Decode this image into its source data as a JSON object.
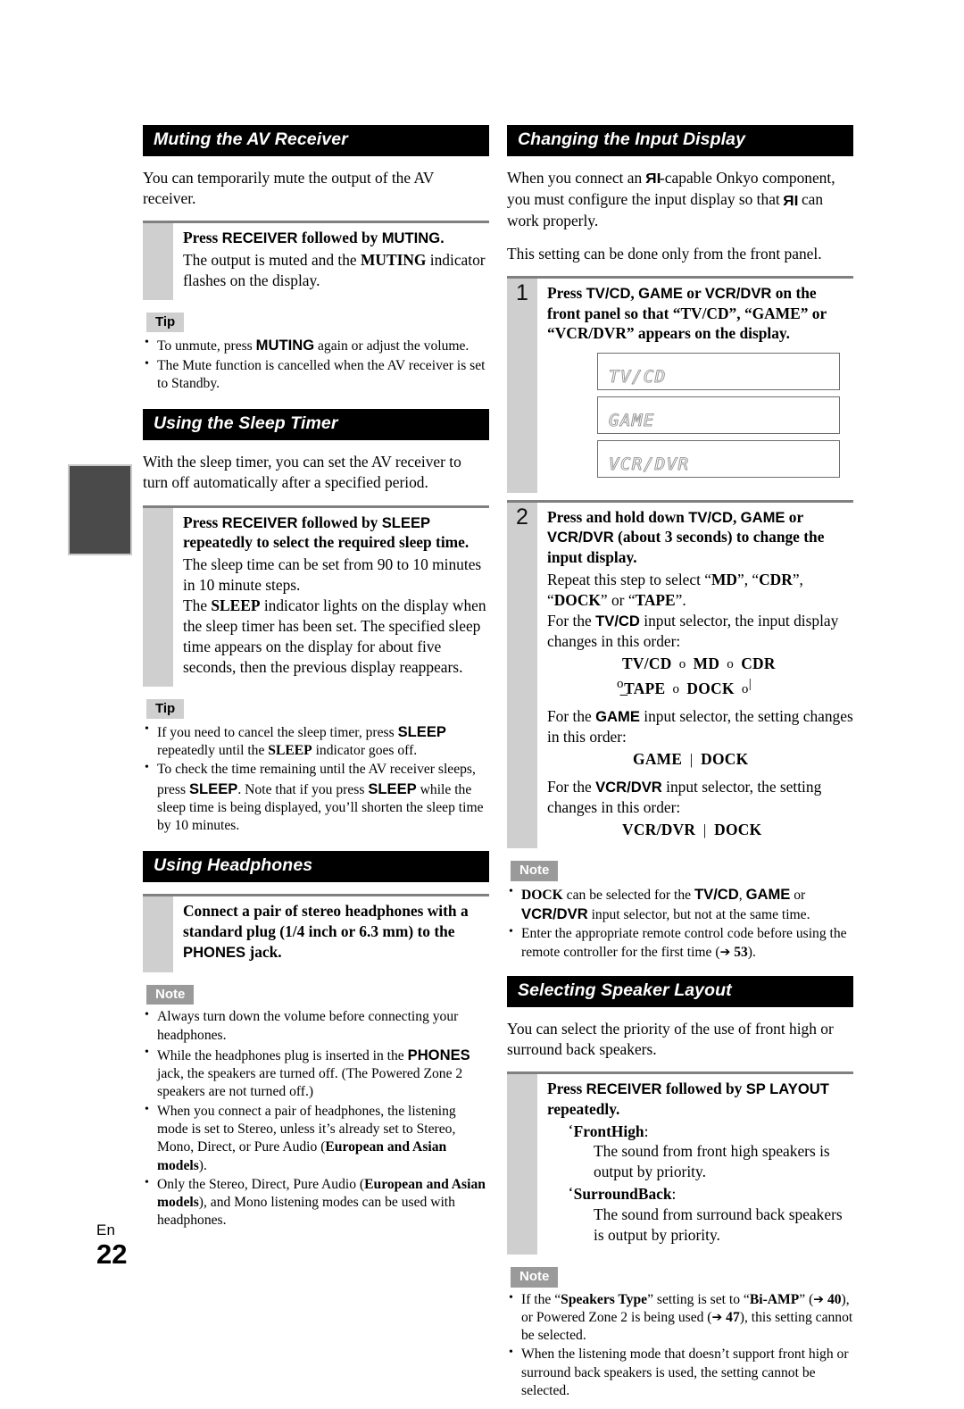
{
  "page": {
    "language_code": "En",
    "page_number": "22"
  },
  "left_column": {
    "muting": {
      "banner": "Muting the AV Receiver",
      "intro": "You can temporarily mute the output of the AV receiver.",
      "step": {
        "lead_1": "Press ",
        "lead_key_1": "RECEIVER",
        "lead_2": " followed by ",
        "lead_key_2": "MUTING.",
        "body_1": "The output is muted and the ",
        "body_key": "MUTING",
        "body_2": " indicator flashes on the display."
      },
      "tip_label": "Tip",
      "tips": [
        "To unmute, press MUTING again or adjust the volume.",
        "The Mute function is cancelled when the AV receiver is set to Standby."
      ]
    },
    "sleep_timer": {
      "banner": "Using the Sleep Timer",
      "intro": "With the sleep timer, you can set the AV receiver to turn off automatically after a specified period.",
      "step": {
        "lead_1": "Press ",
        "lead_key_1": "RECEIVER",
        "lead_2": " followed by ",
        "lead_key_2": "SLEEP",
        "lead_3": " repeatedly to select the required sleep time.",
        "para_1": "The sleep time can be set from 90 to 10 minutes in 10 minute steps.",
        "para_2a": "The ",
        "para_2_key": "SLEEP",
        "para_2b": " indicator lights on the display when the sleep timer has been set. The specified sleep time appears on the display for about five seconds, then the previous display reappears."
      },
      "tip_label": "Tip",
      "tips": [
        "If you need to cancel the sleep timer, press SLEEP repeatedly until the SLEEP indicator goes off.",
        "To check the time remaining until the AV receiver sleeps, press SLEEP. Note that if you press SLEEP while the sleep time is being displayed, you'll shorten the sleep time by 10 minutes."
      ]
    },
    "headphones": {
      "banner": "Using Headphones",
      "step": {
        "lead_1": "Connect a pair of stereo headphones with a standard plug (1/4 inch or 6.3 mm) to the ",
        "lead_key": "PHONES",
        "lead_2": " jack."
      },
      "note_label": "Note",
      "notes": [
        "Always turn down the volume before connecting your headphones.",
        "While the headphones plug is inserted in the PHONES jack, the speakers are turned off. (The Powered Zone 2 speakers are not turned off.)",
        "When you connect a pair of headphones, the listening mode is set to Stereo, unless it's already set to Stereo, Mono, Direct, or Pure Audio (European and Asian models).",
        "Only the Stereo, Direct, Pure Audio (European and Asian models), and Mono listening modes can be used with headphones."
      ]
    }
  },
  "right_column": {
    "input_display": {
      "banner": "Changing the Input Display",
      "intro_1": "When you connect an ",
      "intro_ri": "RI",
      "intro_2": "-capable Onkyo component, you must configure the input display so that ",
      "intro_3": " can work properly.",
      "intro_4": "This setting can be done only from the front panel.",
      "step1": {
        "number": "1",
        "lead_1": "Press ",
        "lead_key_1": "TV/CD",
        "lead_2": ", ",
        "lead_key_2": "GAME",
        "lead_3": " or ",
        "lead_key_3": "VCR/DVR",
        "lead_4": " on the front panel so that “TV/CD”, “GAME” or “VCR/DVR” appears on the display.",
        "lcd_displays": [
          "TV/CD",
          "GAME",
          "VCR/DVR"
        ]
      },
      "step2": {
        "number": "2",
        "lead_1": "Press and hold down ",
        "lead_key_1": "TV/CD",
        "lead_2": ", ",
        "lead_key_2": "GAME",
        "lead_3": " or ",
        "lead_key_3": "VCR/DVR",
        "lead_4": " (about 3 seconds) to change the input display.",
        "para_1a": "Repeat this step to select “",
        "para_1_k1": "MD",
        "para_1b": "”, “",
        "para_1_k2": "CDR",
        "para_1c": "”, “",
        "para_1_k3": "DOCK",
        "para_1d": "” or “",
        "para_1_k4": "TAPE",
        "para_1e": "”.",
        "para_2a": "For the ",
        "para_2_key": "TV/CD",
        "para_2b": " input selector, the input display changes in this order:",
        "flow_tvcd_line1": [
          "TV/CD",
          "MD",
          "CDR"
        ],
        "flow_tvcd_line2": [
          "TAPE",
          "DOCK"
        ],
        "para_3a": "For the ",
        "para_3_key": "GAME",
        "para_3b": " input selector, the setting changes in this order:",
        "flow_game": [
          "GAME",
          "DOCK"
        ],
        "para_4a": "For the ",
        "para_4_key": "VCR/DVR",
        "para_4b": " input selector, the setting changes in this order:",
        "flow_vcrdvr": [
          "VCR/DVR",
          "DOCK"
        ]
      },
      "note_label": "Note",
      "notes": [
        "DOCK can be selected for the TV/CD, GAME or VCR/DVR input selector, but not at the same time.",
        "Enter the appropriate remote control code before using the remote controller for the first time (➔ 53)."
      ]
    },
    "speaker_layout": {
      "banner": "Selecting Speaker Layout",
      "intro": "You can select the priority of the use of front high or surround back speakers.",
      "step": {
        "lead_1": "Press ",
        "lead_key_1": "RECEIVER",
        "lead_2": " followed by ",
        "lead_key_2": "SP LAYOUT",
        "lead_3": " repeatedly.",
        "option_1_label": "FrontHigh",
        "option_1_desc": "The sound from front high speakers is output by priority.",
        "option_2_label": "SurroundBack",
        "option_2_desc": "The sound from surround back speakers is output by priority."
      },
      "note_label": "Note",
      "notes": [
        "If the “Speakers Type” setting is set to “Bi-AMP” (➔ 40), or Powered Zone 2 is being used (➔ 47), this setting cannot be selected.",
        "When the listening mode that doesn't support front high or surround back speakers is used, the setting cannot be selected."
      ]
    }
  }
}
